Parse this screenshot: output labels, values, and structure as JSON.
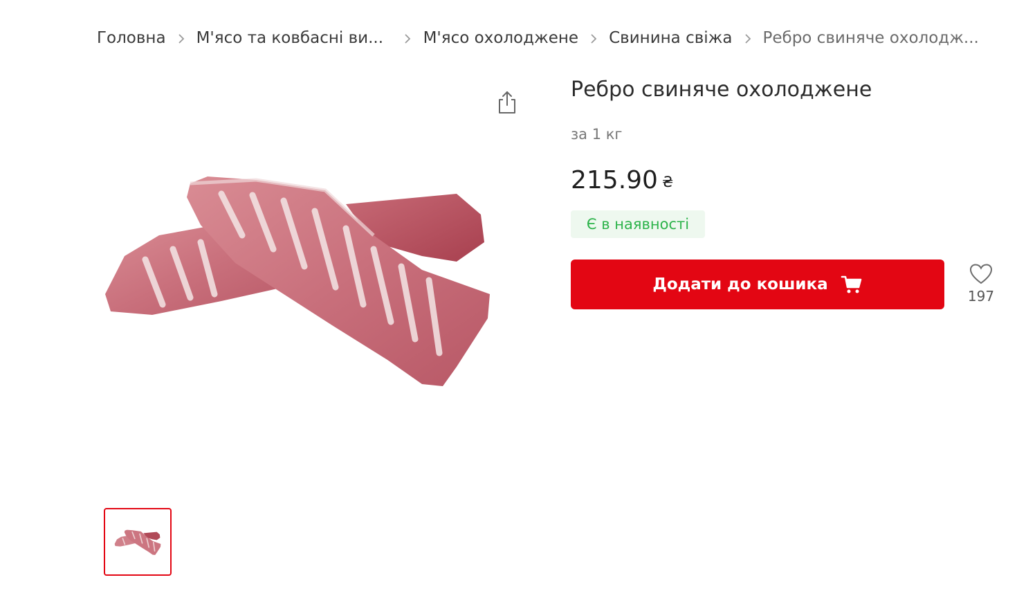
{
  "breadcrumb": {
    "items": [
      {
        "label": "Головна"
      },
      {
        "label": "М'ясо та ковбасні ви..."
      },
      {
        "label": "М'ясо охолоджене"
      },
      {
        "label": "Свинина свіжа"
      },
      {
        "label": "Ребро свиняче охолодж..."
      }
    ]
  },
  "product": {
    "title": "Ребро свиняче охолоджене",
    "unit": "за 1 кг",
    "price": "215.90",
    "currency": "₴",
    "availability": "Є в наявності",
    "add_to_cart_label": "Додати до кошика",
    "favorites_count": "197",
    "image_icon": "pork-ribs-image"
  },
  "colors": {
    "accent": "#e30613",
    "stock_text": "#2cb34a",
    "stock_bg": "#eef8ef"
  }
}
